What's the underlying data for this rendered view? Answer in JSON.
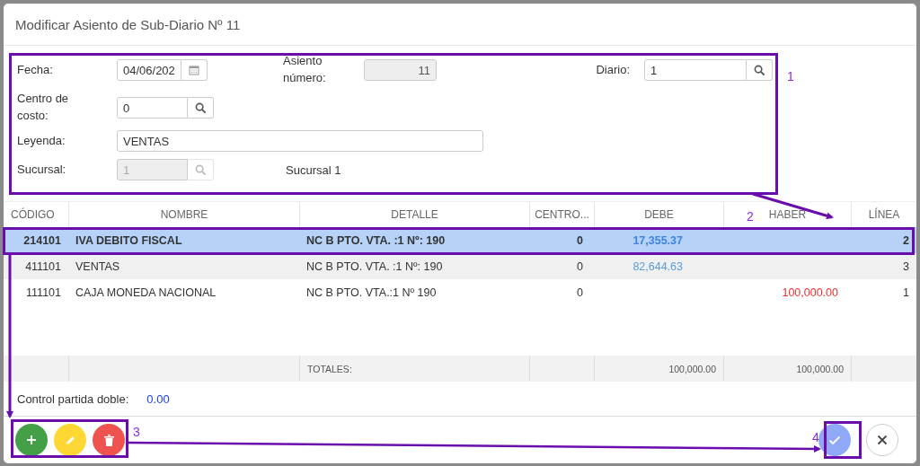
{
  "dialog": {
    "title": "Modificar Asiento de Sub-Diario Nº 11"
  },
  "form": {
    "fecha": {
      "label": "Fecha:",
      "value": "04/06/202"
    },
    "asiento": {
      "label": "Asiento número:",
      "value": "11",
      "disabled": true
    },
    "diario": {
      "label": "Diario:",
      "value": "1",
      "disabled": false
    },
    "centro": {
      "label": "Centro de costo:",
      "value": "0",
      "disabled": false
    },
    "leyenda": {
      "label": "Leyenda:",
      "value": "VENTAS"
    },
    "sucursal": {
      "label": "Sucursal:",
      "value": "1",
      "disabled": true,
      "name": "Sucursal 1"
    }
  },
  "table": {
    "columns": [
      "CÓDIGO",
      "NOMBRE",
      "DETALLE",
      "CENTRO...",
      "DEBE",
      "HABER",
      "LÍNEA"
    ],
    "rows": [
      {
        "codigo": "214101",
        "nombre": "IVA DEBITO FISCAL",
        "detalle": "NC B PTO. VTA. :1 Nº: 190",
        "centro": "0",
        "debe": "17,355.37",
        "haber": "",
        "linea": "2",
        "selected": true
      },
      {
        "codigo": "411101",
        "nombre": "VENTAS",
        "detalle": "NC B PTO. VTA. :1 Nº: 190",
        "centro": "0",
        "debe": "82,644.63",
        "haber": "",
        "linea": "3",
        "selected": false
      },
      {
        "codigo": "111101",
        "nombre": "CAJA MONEDA NACIONAL",
        "detalle": "NC B PTO. VTA.:1 Nº 190",
        "centro": "0",
        "debe": "",
        "haber": "100,000.00",
        "linea": "1",
        "selected": false
      }
    ],
    "totals": {
      "label": "TOTALES:",
      "debe": "100,000.00",
      "haber": "100,000.00"
    }
  },
  "control": {
    "label": "Control partida doble:",
    "value": "0.00"
  },
  "footer": {
    "left_buttons": [
      {
        "kind": "add"
      },
      {
        "kind": "edit"
      },
      {
        "kind": "delete"
      }
    ],
    "right_buttons": [
      {
        "kind": "confirm"
      },
      {
        "kind": "close"
      }
    ]
  },
  "annotations": [
    {
      "label": "1"
    },
    {
      "label": "2"
    },
    {
      "label": "3"
    },
    {
      "label": "4"
    }
  ]
}
